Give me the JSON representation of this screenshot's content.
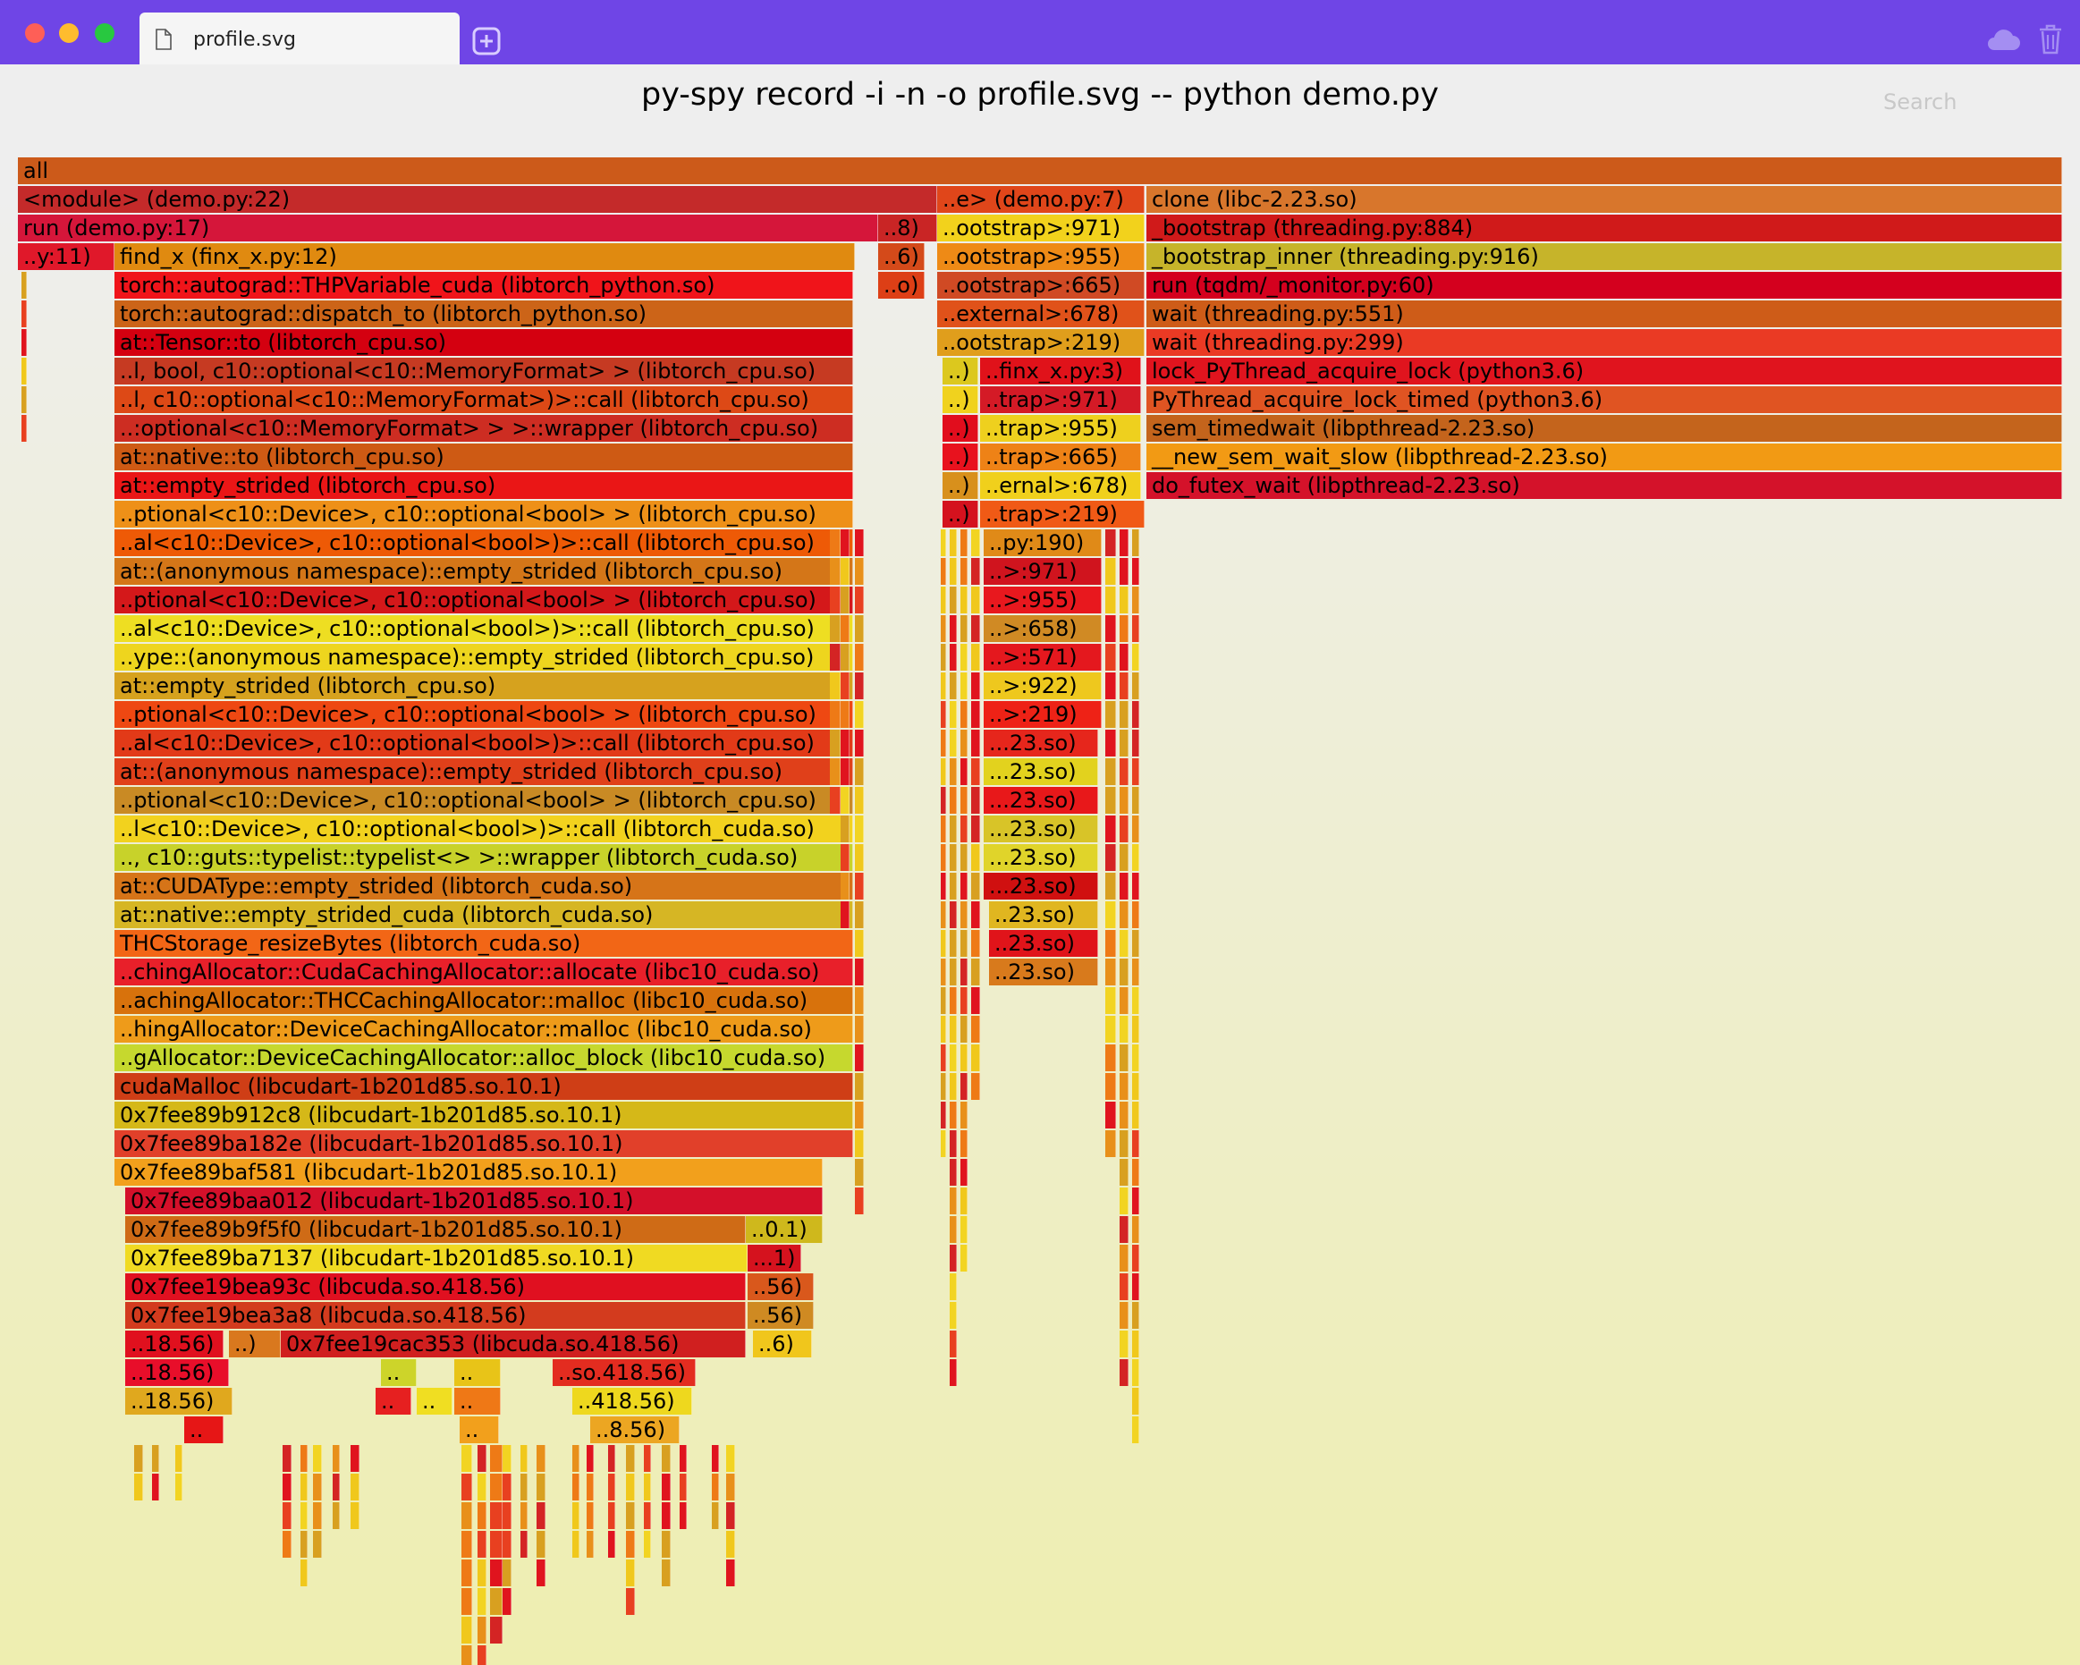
{
  "window": {
    "tab": {
      "label": "profile.svg",
      "icon": "file-icon"
    },
    "new_tab_icon": "plus-square-icon",
    "cloud_icon": "cloud-icon",
    "trash_icon": "trash-icon",
    "titlebar_color": "#6f45e6"
  },
  "page": {
    "title": "py-spy record -i -n -o profile.svg -- python demo.py",
    "search_label": "Search"
  },
  "frames": [
    {
      "label": "all",
      "color": "#cc5a1a"
    },
    {
      "label": "<module> (demo.py:22)",
      "color": "#c42a2a"
    },
    {
      "label": "run (demo.py:17)",
      "color": "#d5163a"
    },
    {
      "label": "..8)",
      "color": "#c92525"
    },
    {
      "label": "..y:11)",
      "color": "#e0182a"
    },
    {
      "label": "find_x (finx_x.py:12)",
      "color": "#e08a10"
    },
    {
      "label": "..6)",
      "color": "#d44a1a"
    },
    {
      "label": "torch::autograd::THPVariable_cuda (libtorch_python.so)",
      "color": "#f0141a"
    },
    {
      "label": "..o)",
      "color": "#dd3f16"
    },
    {
      "label": "torch::autograd::dispatch_to (libtorch_python.so)",
      "color": "#cc6418"
    },
    {
      "label": "at::Tensor::to (libtorch_cpu.so)",
      "color": "#d40010"
    },
    {
      "label": "..l, bool, c10::optional<c10::MemoryFormat> > (libtorch_cpu.so)",
      "color": "#c63a22"
    },
    {
      "label": "..l, c10::optional<c10::MemoryFormat>)>::call (libtorch_cpu.so)",
      "color": "#dd4916"
    },
    {
      "label": "..:optional<c10::MemoryFormat> > >::wrapper (libtorch_cpu.so)",
      "color": "#cd2d22"
    },
    {
      "label": "at::native::to (libtorch_cpu.so)",
      "color": "#ce5a14"
    },
    {
      "label": "at::empty_strided (libtorch_cpu.so)",
      "color": "#ea1616"
    },
    {
      "label": "..ptional<c10::Device>, c10::optional<bool> > (libtorch_cpu.so)",
      "color": "#ee9018"
    },
    {
      "label": "..al<c10::Device>, c10::optional<bool>)>::call (libtorch_cpu.so)",
      "color": "#ee5a06"
    },
    {
      "label": "at::(anonymous namespace)::empty_strided (libtorch_cpu.so)",
      "color": "#d47618"
    },
    {
      "label": "..ptional<c10::Device>, c10::optional<bool> > (libtorch_cpu.so)",
      "color": "#d4181a"
    },
    {
      "label": "..al<c10::Device>, c10::optional<bool>)>::call (libtorch_cpu.so)",
      "color": "#eede22"
    },
    {
      "label": "..ype::(anonymous namespace)::empty_strided (libtorch_cpu.so)",
      "color": "#eed51e"
    },
    {
      "label": "at::empty_strided (libtorch_cpu.so)",
      "color": "#d6a21e"
    },
    {
      "label": "..ptional<c10::Device>, c10::optional<bool> > (libtorch_cpu.so)",
      "color": "#ee4812"
    },
    {
      "label": "..al<c10::Device>, c10::optional<bool>)>::call (libtorch_cpu.so)",
      "color": "#e23a18"
    },
    {
      "label": "at::(anonymous namespace)::empty_strided (libtorch_cpu.so)",
      "color": "#e0401a"
    },
    {
      "label": "..ptional<c10::Device>, c10::optional<bool> > (libtorch_cpu.so)",
      "color": "#c98a24"
    },
    {
      "label": "..l<c10::Device>, c10::optional<bool>)>::call (libtorch_cuda.so)",
      "color": "#f2d21e"
    },
    {
      "label": ".., c10::guts::typelist::typelist<> >::wrapper (libtorch_cuda.so)",
      "color": "#c8d22a"
    },
    {
      "label": "at::CUDAType::empty_strided (libtorch_cuda.so)",
      "color": "#d67418"
    },
    {
      "label": "at::native::empty_strided_cuda (libtorch_cuda.so)",
      "color": "#d6b624"
    },
    {
      "label": "THCStorage_resizeBytes (libtorch_cuda.so)",
      "color": "#f26616"
    },
    {
      "label": "..chingAllocator::CudaCachingAllocator::allocate (libc10_cuda.so)",
      "color": "#e8202a"
    },
    {
      "label": "..achingAllocator::THCCachingAllocator::malloc (libc10_cuda.so)",
      "color": "#d8720c"
    },
    {
      "label": "..hingAllocator::DeviceCachingAllocator::malloc (libc10_cuda.so)",
      "color": "#ee9b1a"
    },
    {
      "label": "..gAllocator::DeviceCachingAllocator::alloc_block (libc10_cuda.so)",
      "color": "#c6d82e"
    },
    {
      "label": "cudaMalloc (libcudart-1b201d85.so.10.1)",
      "color": "#cf3e16"
    },
    {
      "label": "0x7fee89b912c8 (libcudart-1b201d85.so.10.1)",
      "color": "#d5b818"
    },
    {
      "label": "0x7fee89ba182e (libcudart-1b201d85.so.10.1)",
      "color": "#e1402a"
    },
    {
      "label": "0x7fee89baf581 (libcudart-1b201d85.so.10.1)",
      "color": "#f2a01c"
    },
    {
      "label": "0x7fee89baa012 (libcudart-1b201d85.so.10.1)",
      "color": "#d4102a"
    },
    {
      "label": "0x7fee89b9f5f0 (libcudart-1b201d85.so.10.1)",
      "color": "#cf6b16"
    },
    {
      "label": "..0.1)",
      "color": "#cfb81c"
    },
    {
      "label": "0x7fee89ba7137 (libcudart-1b201d85.so.10.1)",
      "color": "#f0da22"
    },
    {
      "label": "...1)",
      "color": "#d5121e"
    },
    {
      "label": "0x7fee19bea93c (libcuda.so.418.56)",
      "color": "#e01020"
    },
    {
      "label": "..56)",
      "color": "#d9581c"
    },
    {
      "label": "0x7fee19bea3a8 (libcuda.so.418.56)",
      "color": "#d33b1e"
    },
    {
      "label": "..56)",
      "color": "#cf8a22"
    },
    {
      "label": "..18.56)",
      "color": "#e0101e"
    },
    {
      "label": "..)",
      "color": "#d9781e"
    },
    {
      "label": "0x7fee19cac353 (libcuda.so.418.56)",
      "color": "#d01f1f"
    },
    {
      "label": "..6)",
      "color": "#f0c61c"
    },
    {
      "label": "..18.56)",
      "color": "#e80e2a"
    },
    {
      "label": "..",
      "color": "#cdd42a"
    },
    {
      "label": "..",
      "color": "#e8c418"
    },
    {
      "label": "..so.418.56)",
      "color": "#e32c20"
    },
    {
      "label": "..18.56)",
      "color": "#e0a81e"
    },
    {
      "label": "..",
      "color": "#e62020"
    },
    {
      "label": "..",
      "color": "#f0de22"
    },
    {
      "label": "..",
      "color": "#ef7816"
    },
    {
      "label": "..418.56)",
      "color": "#eed81e"
    },
    {
      "label": "..",
      "color": "#e61616"
    },
    {
      "label": "..",
      "color": "#f2a01c"
    },
    {
      "label": "..8.56)",
      "color": "#eca622"
    },
    {
      "label": "..e> (demo.py:7)",
      "color": "#e0461a"
    },
    {
      "label": "clone (libc-2.23.so)",
      "color": "#d8762c"
    },
    {
      "label": "..ootstrap>:971)",
      "color": "#f2d21c"
    },
    {
      "label": "_bootstrap (threading.py:884)",
      "color": "#d01a1a"
    },
    {
      "label": "..ootstrap>:955)",
      "color": "#ee8a16"
    },
    {
      "label": "_bootstrap_inner (threading.py:916)",
      "color": "#c6b42a"
    },
    {
      "label": "..ootstrap>:665)",
      "color": "#d04a24"
    },
    {
      "label": "run (tqdm/_monitor.py:60)",
      "color": "#d4001e"
    },
    {
      "label": "..external>:678)",
      "color": "#e0521a"
    },
    {
      "label": "wait (threading.py:551)",
      "color": "#ce5c18"
    },
    {
      "label": "..ootstrap>:219)",
      "color": "#e09e1c"
    },
    {
      "label": "wait (threading.py:299)",
      "color": "#ea3a24"
    },
    {
      "label": "..)",
      "color": "#dcc81e"
    },
    {
      "label": "..finx_x.py:3)",
      "color": "#e0121a"
    },
    {
      "label": "lock_PyThread_acquire_lock (python3.6)",
      "color": "#e0141e"
    },
    {
      "label": "..)",
      "color": "#f0d21e"
    },
    {
      "label": "..trap>:971)",
      "color": "#d41a26"
    },
    {
      "label": "PyThread_acquire_lock_timed (python3.6)",
      "color": "#e05422"
    },
    {
      "label": "..)",
      "color": "#e10d1d"
    },
    {
      "label": "..trap>:955)",
      "color": "#eed01e"
    },
    {
      "label": "sem_timedwait (libpthread-2.23.so)",
      "color": "#c4641c"
    },
    {
      "label": "..)",
      "color": "#e8121e"
    },
    {
      "label": "..trap>:665)",
      "color": "#ee8216"
    },
    {
      "label": "__new_sem_wait_slow (libpthread-2.23.so)",
      "color": "#f29a14"
    },
    {
      "label": "..)",
      "color": "#d8901c"
    },
    {
      "label": "..ernal>:678)",
      "color": "#f0d01c"
    },
    {
      "label": "do_futex_wait (libpthread-2.23.so)",
      "color": "#d4122a"
    },
    {
      "label": "..)",
      "color": "#d4121e"
    },
    {
      "label": "..trap>:219)",
      "color": "#f05a16"
    },
    {
      "label": "..py:190)",
      "color": "#e08a18"
    },
    {
      "label": "..>:971)",
      "color": "#d0141e"
    },
    {
      "label": "..>:955)",
      "color": "#e8181e"
    },
    {
      "label": "..>:658)",
      "color": "#d08a24"
    },
    {
      "label": "..>:571)",
      "color": "#e4181e"
    },
    {
      "label": "..>:922)",
      "color": "#eec81e"
    },
    {
      "label": "..>:219)",
      "color": "#ee2216"
    },
    {
      "label": "...23.so)",
      "color": "#e6261c"
    },
    {
      "label": "...23.so)",
      "color": "#e2d21e"
    },
    {
      "label": "...23.so)",
      "color": "#e8181a"
    },
    {
      "label": "...23.so)",
      "color": "#d8c428"
    },
    {
      "label": "...23.so)",
      "color": "#e0d42a"
    },
    {
      "label": "...23.so)",
      "color": "#d01010"
    },
    {
      "label": "..23.so)",
      "color": "#e0b620"
    },
    {
      "label": "..23.so)",
      "color": "#e0141a"
    },
    {
      "label": "..23.so)",
      "color": "#d87a1c"
    }
  ]
}
